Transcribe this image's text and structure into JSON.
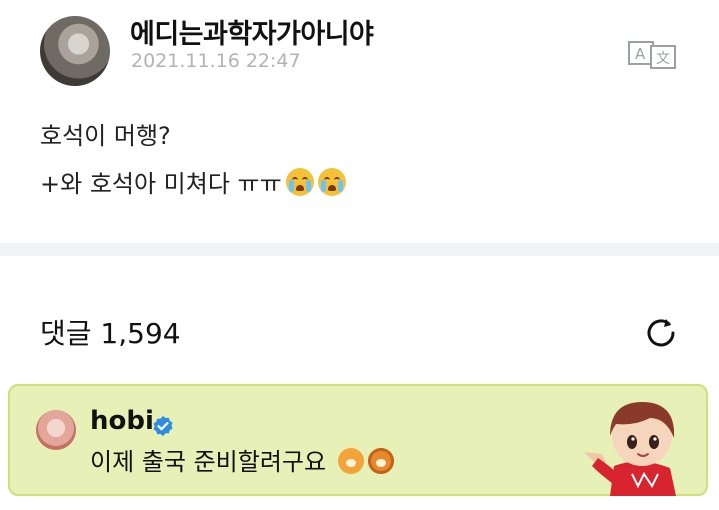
{
  "post": {
    "author": "에디는과학자가아니야",
    "timestamp": "2021.11.16 22:47",
    "line1": "호석이 머행?",
    "line2": "+와 호석아 미쳐다 ㅠㅠ"
  },
  "icons": {
    "translate": "translate-icon",
    "refresh": "refresh-icon",
    "verified": "verified-badge-icon",
    "crying_emoji": "loudly-crying-face-emoji",
    "tiger_emoji": "tiger-face-emoji",
    "lion_emoji": "lion-face-emoji"
  },
  "comments": {
    "label": "댓글 1,594"
  },
  "banner": {
    "name": "hobi",
    "text": "이제 출국 준비할려구요"
  },
  "colors": {
    "banner_bg": "#e6f0b7",
    "banner_border": "#cfe07a",
    "timestamp": "#b3b3b3",
    "verified": "#2f8be0"
  }
}
